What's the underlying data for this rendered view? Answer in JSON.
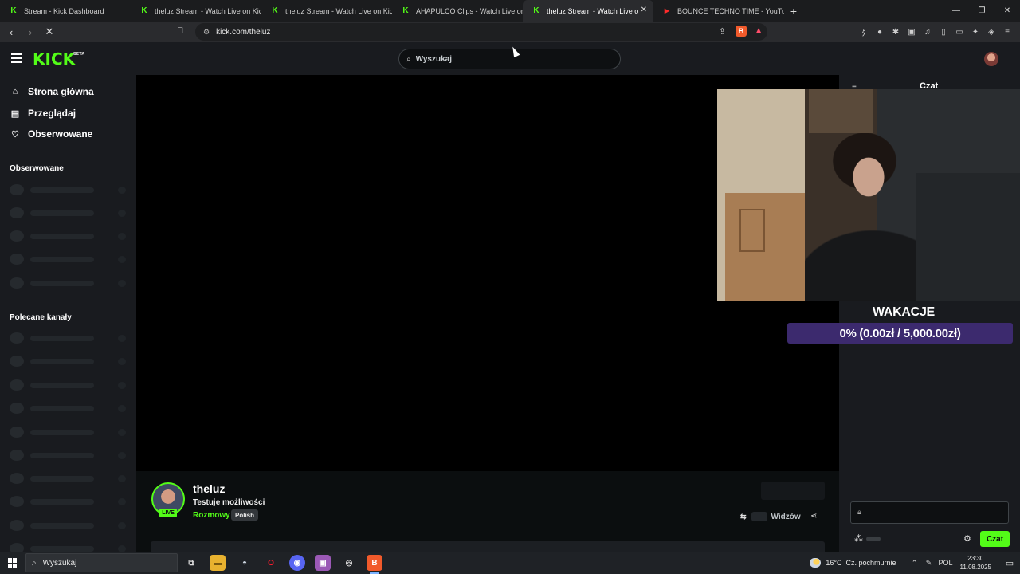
{
  "browser": {
    "tabs": [
      {
        "title": "Stream - Kick Dashboard",
        "favicon": "kick-icon",
        "active": false
      },
      {
        "title": "theluz Stream - Watch Live on Kick",
        "favicon": "kick-icon",
        "active": false
      },
      {
        "title": "theluz Stream - Watch Live on Kick",
        "favicon": "kick-icon",
        "active": false
      },
      {
        "title": "AHAPULCO Clips - Watch Live on Kick",
        "favicon": "kick-icon",
        "active": false
      },
      {
        "title": "theluz Stream - Watch Live on Kick",
        "favicon": "kick-icon",
        "active": true
      },
      {
        "title": "BOUNCE TECHNO TIME - YouTube",
        "favicon": "youtube-icon",
        "active": false
      }
    ],
    "url": "kick.com/theluz"
  },
  "kick": {
    "logo": "KICK",
    "logo_badge": "BETA",
    "search_placeholder": "Wyszukaj",
    "accent": "#53fc18"
  },
  "sidebar": {
    "nav": [
      {
        "label": "Strona główna",
        "icon": "home-icon"
      },
      {
        "label": "Przeglądaj",
        "icon": "browse-icon"
      },
      {
        "label": "Obserwowane",
        "icon": "heart-icon"
      }
    ],
    "followed_heading": "Obserwowane",
    "recommended_heading": "Polecane kanały"
  },
  "stream": {
    "goal_title": "WAKACJE",
    "goal_text": "0% (0.00zł / 5,000.00zł)",
    "goal_progress": 0,
    "goal_color": "#6b3fd0"
  },
  "chat": {
    "title": "Czat",
    "send_label": "Czat"
  },
  "channel": {
    "name": "theluz",
    "live_label": "LIVE",
    "stream_title": "Testuje możliwości",
    "category": "Rozmowy",
    "language": "Polish",
    "viewers_label": "Widzów"
  },
  "taskbar": {
    "search_placeholder": "Wyszukaj",
    "temperature": "16°C",
    "weather": "Cz. pochmurnie",
    "language": "POL",
    "time": "23:30",
    "date": "11.08.2025"
  }
}
